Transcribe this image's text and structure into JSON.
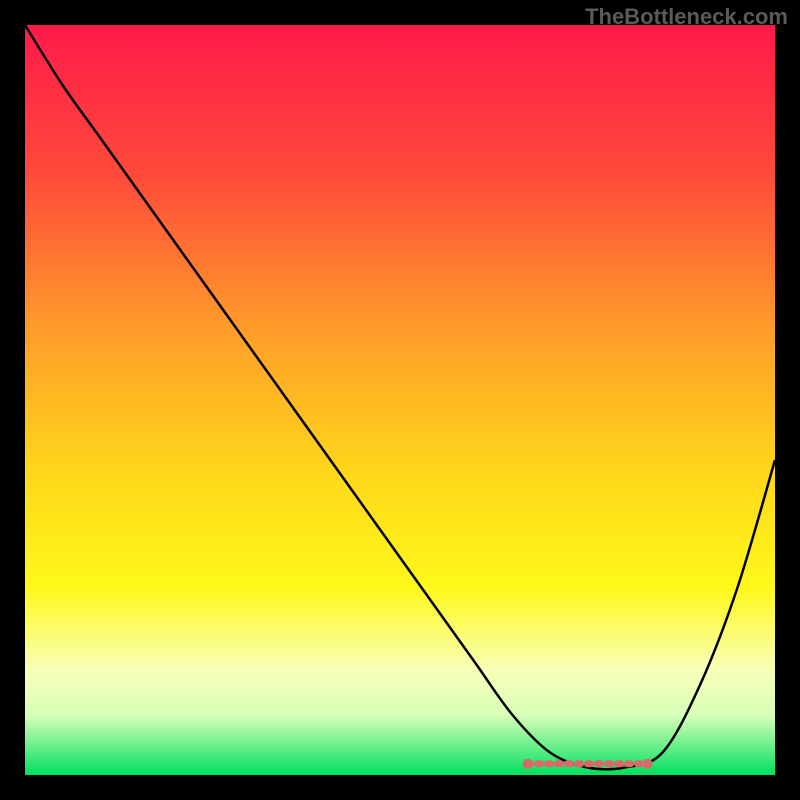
{
  "watermark": "TheBottleneck.com",
  "chart_data": {
    "type": "line",
    "title": "",
    "xlabel": "",
    "ylabel": "",
    "xlim": [
      0,
      100
    ],
    "ylim": [
      0,
      100
    ],
    "gradient_stops": [
      {
        "offset": 0,
        "color": "#ff1a4a"
      },
      {
        "offset": 20,
        "color": "#ff4a3a"
      },
      {
        "offset": 40,
        "color": "#ff9a2a"
      },
      {
        "offset": 60,
        "color": "#ffd81a"
      },
      {
        "offset": 75,
        "color": "#fff81a"
      },
      {
        "offset": 86,
        "color": "#f8ffb8"
      },
      {
        "offset": 92,
        "color": "#d8ffb8"
      },
      {
        "offset": 100,
        "color": "#00e060"
      }
    ],
    "series": [
      {
        "name": "bottleneck-curve",
        "color": "#000000",
        "x": [
          0,
          5,
          10,
          15,
          20,
          25,
          30,
          35,
          40,
          45,
          50,
          55,
          60,
          65,
          70,
          75,
          80,
          85,
          90,
          95,
          100
        ],
        "y": [
          100,
          92,
          85,
          78,
          71,
          64,
          57,
          50,
          43,
          36,
          29,
          22,
          15,
          8,
          3,
          1,
          1,
          3,
          12,
          25,
          42
        ]
      }
    ],
    "highlight_band": {
      "name": "optimal-zone",
      "color": "#d96a6a",
      "x_start": 67,
      "x_end": 83,
      "y": 1.5
    }
  }
}
